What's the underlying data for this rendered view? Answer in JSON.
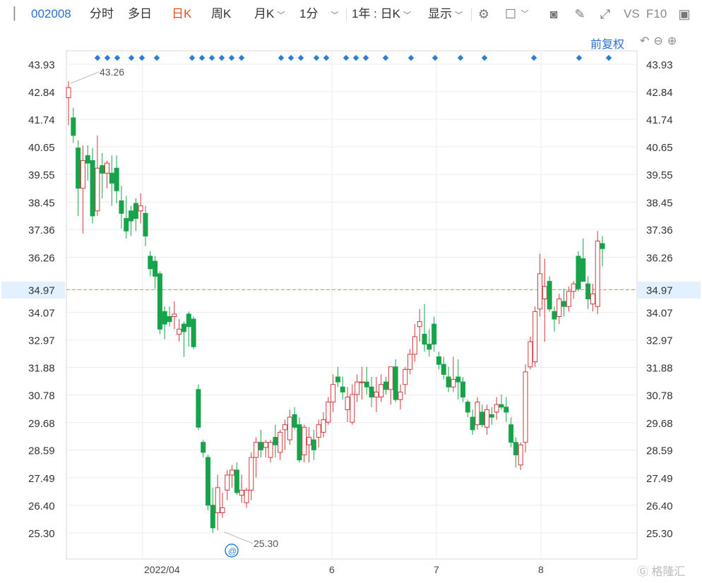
{
  "toolbar": {
    "code": "002008",
    "tabs": [
      "分时",
      "多日",
      "日K",
      "周K",
      "月K",
      "1分"
    ],
    "active_tab": "日K",
    "period_range": "1年 : 日K",
    "display": "显示",
    "vs": "VS",
    "f10": "F10"
  },
  "fuquan": "前复权",
  "current_price_label": "34.97",
  "watermark": "格隆汇",
  "annotations": {
    "high": "43.26",
    "low": "25.30"
  },
  "colors": {
    "up": "#d0393e",
    "down": "#16a34a",
    "price_line": "#f08c3a",
    "marker": "#2a7fd4",
    "price_bg": "#e3f0ff"
  },
  "icons": [
    "settings-icon",
    "box-icon",
    "camera-icon",
    "pen-icon",
    "fullscreen-icon",
    "panel-icon",
    "undo-icon",
    "zoom-out-icon",
    "zoom-in-icon"
  ],
  "chart_data": {
    "type": "candlestick",
    "yticks": [
      "43.93",
      "42.84",
      "41.74",
      "40.65",
      "39.55",
      "38.45",
      "37.36",
      "36.26",
      "34.97",
      "34.07",
      "32.97",
      "31.88",
      "30.78",
      "29.68",
      "28.59",
      "27.49",
      "26.40",
      "25.30"
    ],
    "xticks": [
      "2022/04",
      "6",
      "7",
      "8"
    ],
    "current_price": 34.97,
    "ohlc": [
      [
        42.6,
        43.26,
        41.5,
        43.0
      ],
      [
        41.8,
        42.2,
        40.8,
        41.1
      ],
      [
        40.6,
        40.9,
        37.9,
        39.0
      ],
      [
        39.0,
        40.7,
        37.2,
        40.1
      ],
      [
        40.3,
        40.7,
        39.3,
        40.0
      ],
      [
        40.1,
        40.6,
        37.6,
        37.9
      ],
      [
        38.1,
        41.1,
        37.9,
        39.8
      ],
      [
        39.9,
        40.4,
        38.6,
        39.6
      ],
      [
        39.6,
        40.1,
        39.0,
        40.0
      ],
      [
        39.6,
        40.3,
        38.3,
        39.2
      ],
      [
        39.8,
        40.3,
        38.4,
        38.9
      ],
      [
        38.5,
        39.1,
        37.4,
        38.0
      ],
      [
        37.8,
        38.7,
        37.0,
        37.3
      ],
      [
        38.1,
        38.3,
        37.1,
        37.7
      ],
      [
        38.4,
        38.6,
        37.3,
        37.8
      ],
      [
        38.1,
        38.8,
        37.6,
        38.3
      ],
      [
        38.0,
        38.3,
        36.7,
        37.1
      ],
      [
        36.3,
        36.5,
        35.5,
        35.8
      ],
      [
        36.1,
        36.3,
        35.0,
        35.5
      ],
      [
        35.6,
        35.7,
        33.2,
        33.4
      ],
      [
        34.1,
        34.3,
        33.0,
        33.6
      ],
      [
        33.9,
        34.3,
        33.5,
        33.7
      ],
      [
        33.9,
        34.5,
        33.4,
        34.0
      ],
      [
        33.2,
        33.8,
        32.9,
        33.4
      ],
      [
        33.6,
        33.7,
        32.3,
        33.3
      ],
      [
        34.0,
        34.1,
        32.7,
        33.5
      ],
      [
        33.8,
        33.9,
        32.6,
        32.7
      ],
      [
        31.0,
        31.2,
        29.4,
        29.5
      ],
      [
        28.9,
        29.0,
        28.3,
        28.5
      ],
      [
        28.3,
        28.4,
        26.2,
        26.4
      ],
      [
        26.4,
        27.1,
        25.3,
        25.5
      ],
      [
        26.1,
        27.6,
        25.4,
        27.1
      ],
      [
        26.1,
        26.9,
        25.9,
        26.3
      ],
      [
        27.0,
        27.8,
        26.6,
        27.6
      ],
      [
        27.6,
        28.0,
        27.1,
        27.8
      ],
      [
        27.8,
        28.1,
        26.8,
        26.9
      ],
      [
        26.8,
        27.6,
        26.5,
        27.0
      ],
      [
        26.5,
        27.1,
        26.3,
        27.0
      ],
      [
        27.0,
        28.5,
        26.6,
        28.3
      ],
      [
        28.3,
        29.1,
        27.5,
        28.9
      ],
      [
        28.9,
        29.4,
        28.3,
        28.6
      ],
      [
        28.7,
        29.0,
        28.3,
        28.9
      ],
      [
        28.3,
        29.0,
        28.1,
        28.9
      ],
      [
        29.1,
        29.6,
        28.3,
        28.8
      ],
      [
        28.5,
        29.4,
        28.2,
        29.3
      ],
      [
        29.4,
        29.8,
        28.6,
        29.6
      ],
      [
        29.0,
        30.2,
        28.8,
        29.9
      ],
      [
        30.0,
        30.3,
        29.4,
        29.5
      ],
      [
        29.6,
        29.9,
        28.1,
        28.2
      ],
      [
        28.4,
        29.6,
        28.1,
        29.5
      ],
      [
        28.8,
        29.5,
        28.1,
        29.1
      ],
      [
        29.0,
        29.4,
        28.2,
        28.6
      ],
      [
        29.1,
        29.8,
        28.7,
        29.6
      ],
      [
        29.3,
        30.1,
        29.1,
        29.8
      ],
      [
        29.7,
        30.7,
        29.6,
        30.5
      ],
      [
        30.5,
        31.6,
        30.1,
        31.2
      ],
      [
        31.5,
        31.9,
        31.1,
        31.3
      ],
      [
        31.1,
        31.5,
        30.6,
        30.9
      ],
      [
        30.2,
        31.1,
        29.7,
        30.7
      ],
      [
        29.7,
        31.2,
        29.6,
        30.8
      ],
      [
        30.8,
        31.6,
        30.5,
        31.3
      ],
      [
        31.3,
        31.9,
        30.6,
        31.3
      ],
      [
        31.3,
        31.9,
        30.8,
        31.1
      ],
      [
        31.1,
        31.5,
        30.3,
        30.7
      ],
      [
        30.7,
        31.5,
        30.1,
        30.9
      ],
      [
        30.7,
        31.6,
        30.5,
        31.2
      ],
      [
        31.3,
        31.5,
        30.8,
        31.0
      ],
      [
        31.0,
        31.7,
        30.4,
        31.9
      ],
      [
        31.9,
        32.2,
        30.5,
        30.6
      ],
      [
        30.6,
        31.2,
        30.2,
        30.9
      ],
      [
        31.2,
        31.9,
        30.8,
        31.8
      ],
      [
        31.8,
        32.6,
        31.6,
        32.4
      ],
      [
        32.4,
        33.6,
        32.1,
        33.1
      ],
      [
        33.5,
        34.2,
        32.9,
        33.7
      ],
      [
        33.2,
        34.4,
        32.5,
        32.8
      ],
      [
        32.8,
        33.4,
        32.3,
        32.6
      ],
      [
        33.6,
        33.9,
        32.5,
        32.8
      ],
      [
        32.3,
        32.5,
        31.8,
        32.0
      ],
      [
        32.0,
        32.3,
        31.4,
        31.6
      ],
      [
        31.5,
        31.9,
        30.9,
        31.1
      ],
      [
        31.1,
        32.3,
        30.9,
        31.4
      ],
      [
        31.5,
        32.2,
        30.6,
        31.3
      ],
      [
        31.3,
        31.5,
        30.5,
        30.7
      ],
      [
        30.5,
        30.6,
        29.9,
        30.1
      ],
      [
        29.9,
        30.2,
        29.2,
        29.4
      ],
      [
        29.6,
        30.7,
        29.4,
        30.5
      ],
      [
        30.1,
        30.4,
        29.5,
        29.6
      ],
      [
        29.5,
        30.4,
        29.2,
        30.2
      ],
      [
        30.0,
        30.3,
        29.6,
        29.9
      ],
      [
        30.1,
        30.7,
        29.8,
        30.4
      ],
      [
        30.4,
        30.8,
        30.2,
        30.3
      ],
      [
        30.3,
        30.7,
        29.7,
        30.1
      ],
      [
        29.6,
        29.9,
        28.7,
        28.9
      ],
      [
        28.9,
        29.1,
        27.9,
        28.4
      ],
      [
        28.0,
        28.9,
        27.8,
        28.8
      ],
      [
        28.9,
        32.0,
        28.5,
        31.7
      ],
      [
        31.9,
        33.1,
        31.8,
        32.9
      ],
      [
        32.1,
        34.3,
        31.9,
        34.1
      ],
      [
        34.2,
        36.4,
        33.9,
        35.6
      ],
      [
        34.6,
        36.2,
        32.9,
        35.1
      ],
      [
        35.3,
        35.5,
        34.1,
        34.2
      ],
      [
        34.1,
        34.3,
        33.3,
        33.8
      ],
      [
        33.9,
        34.8,
        33.6,
        34.6
      ],
      [
        34.5,
        35.0,
        33.9,
        34.3
      ],
      [
        34.3,
        35.1,
        34.1,
        34.9
      ],
      [
        34.9,
        35.3,
        34.6,
        35.2
      ],
      [
        36.3,
        36.5,
        34.9,
        35.0
      ],
      [
        36.2,
        37.0,
        35.3,
        35.3
      ],
      [
        35.2,
        35.5,
        34.2,
        34.6
      ],
      [
        34.4,
        35.2,
        34.1,
        34.8
      ],
      [
        34.3,
        37.3,
        34.0,
        36.9
      ],
      [
        36.8,
        37.1,
        35.9,
        36.6
      ]
    ]
  }
}
